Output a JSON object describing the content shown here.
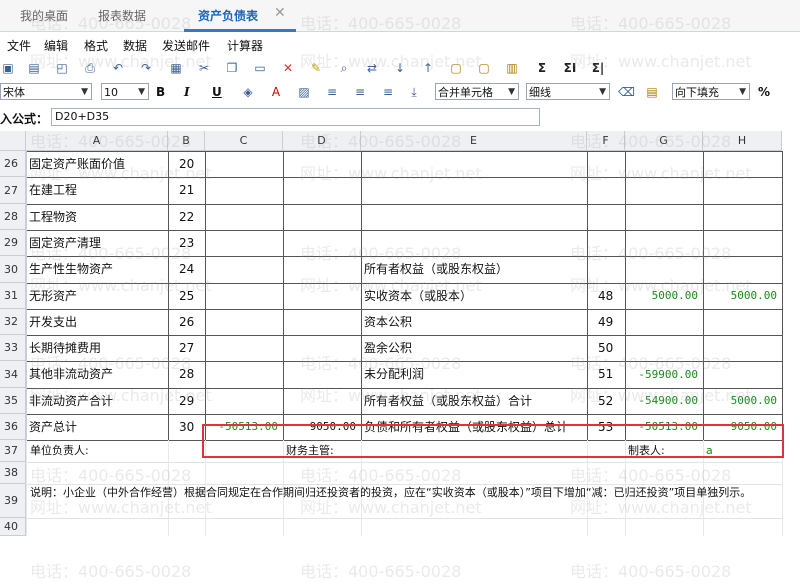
{
  "tabs": [
    {
      "label": "我的桌面"
    },
    {
      "label": "报表数据"
    },
    {
      "label": "资产负债表"
    }
  ],
  "menu": [
    "文件",
    "编辑",
    "格式",
    "数据",
    "发送邮件",
    "计算器"
  ],
  "toolbar": {
    "font_name": "宋体",
    "font_size": "10",
    "merge_select": "合并单元格",
    "border_select": "细线",
    "fill_select": "向下填充",
    "bold": "B",
    "italic": "I",
    "underline": "U",
    "sum": "Σ",
    "sum_i": "ΣI",
    "sum_j": "Σ|",
    "percent": "%"
  },
  "formula": {
    "label": "入公式：",
    "value": "D20+D35"
  },
  "columns": [
    "A",
    "B",
    "C",
    "D",
    "E",
    "F",
    "G",
    "H"
  ],
  "rows": [
    {
      "n": "26",
      "a": "固定资产账面价值",
      "b": "20",
      "c": "",
      "d": "",
      "e": "",
      "f": "",
      "g": "",
      "h": ""
    },
    {
      "n": "27",
      "a": "在建工程",
      "b": "21",
      "c": "",
      "d": "",
      "e": "",
      "f": "",
      "g": "",
      "h": ""
    },
    {
      "n": "28",
      "a": "工程物资",
      "b": "22",
      "c": "",
      "d": "",
      "e": "",
      "f": "",
      "g": "",
      "h": ""
    },
    {
      "n": "29",
      "a": "固定资产清理",
      "b": "23",
      "c": "",
      "d": "",
      "e": "",
      "f": "",
      "g": "",
      "h": ""
    },
    {
      "n": "30",
      "a": "生产性生物资产",
      "b": "24",
      "c": "",
      "d": "",
      "e": "所有者权益（或股东权益）",
      "f": "",
      "g": "",
      "h": ""
    },
    {
      "n": "31",
      "a": "无形资产",
      "b": "25",
      "c": "",
      "d": "",
      "e": "实收资本（或股本）",
      "f": "48",
      "g": "5000.00",
      "h": "5000.00"
    },
    {
      "n": "32",
      "a": "开发支出",
      "b": "26",
      "c": "",
      "d": "",
      "e": "资本公积",
      "f": "49",
      "g": "",
      "h": ""
    },
    {
      "n": "33",
      "a": "长期待摊费用",
      "b": "27",
      "c": "",
      "d": "",
      "e": "盈余公积",
      "f": "50",
      "g": "",
      "h": ""
    },
    {
      "n": "34",
      "a": "其他非流动资产",
      "b": "28",
      "c": "",
      "d": "",
      "e": "未分配利润",
      "f": "51",
      "g": "-59900.00",
      "h": ""
    },
    {
      "n": "35",
      "a": "非流动资产合计",
      "b": "29",
      "c": "",
      "d": "",
      "e": "所有者权益（或股东权益）合计",
      "f": "52",
      "g": "-54900.00",
      "h": "5000.00"
    },
    {
      "n": "36",
      "a": "资产总计",
      "b": "30",
      "c": "-50513.00",
      "d": "9050.00",
      "e": "负债和所有者权益（或股东权益）总计",
      "f": "53",
      "g": "-50513.00",
      "h": "9050.00"
    }
  ],
  "footer_rows": {
    "r37": {
      "n": "37",
      "unit_head": "单位负责人:",
      "finance": "财务主管:",
      "preparer": "制表人:",
      "preparer_value": "a"
    },
    "r38": {
      "n": "38"
    },
    "r39": {
      "n": "39",
      "note": "说明：小企业（中外合作经营）根据合同规定在合作期间归还投资者的投资，应在“实收资本（或股本）”项目下增加“减：已归还投资”项目单独列示。"
    },
    "r40": {
      "n": "40"
    }
  },
  "watermark": {
    "phone": "电话：400-665-0028",
    "site": "网址：www.chanjet.net"
  },
  "colors": {
    "accent": "#2a7bd4",
    "green_value": "#1a8b1a",
    "highlight": "#e0323a"
  }
}
